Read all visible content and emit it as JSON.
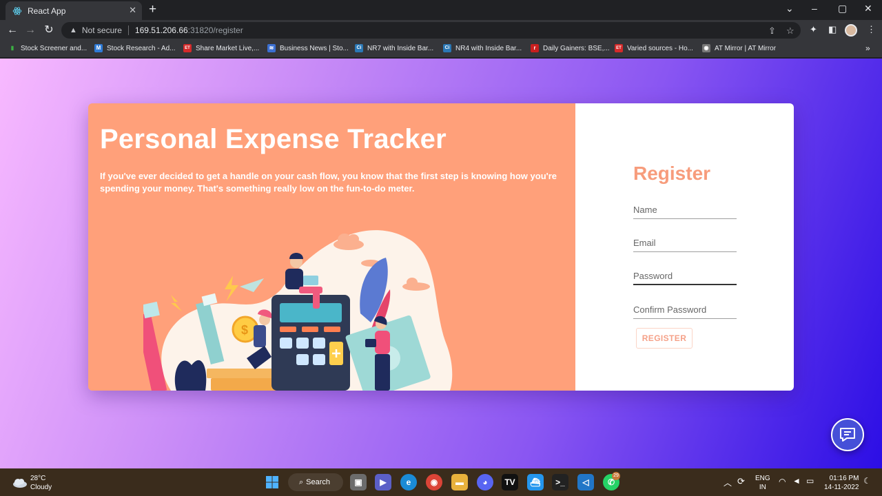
{
  "browser": {
    "tab_title": "React App",
    "url_warning": "Not secure",
    "url_host": "169.51.206.66",
    "url_path": ":31820/register",
    "bookmarks": [
      {
        "label": "Stock Screener and...",
        "color": "#2e8b2e",
        "icon": "chart-bars-icon"
      },
      {
        "label": "Stock Research - Ad...",
        "color": "#2f7bd6",
        "icon": "M"
      },
      {
        "label": "Share Market Live,...",
        "color": "#d42a2a",
        "icon": "ET"
      },
      {
        "label": "Business News | Sto...",
        "color": "#3b6fd1",
        "icon": "news-icon"
      },
      {
        "label": "NR7 with Inside Bar...",
        "color": "#2b78b5",
        "icon": "Ci"
      },
      {
        "label": "NR4 with Inside Bar...",
        "color": "#2b78b5",
        "icon": "Ci"
      },
      {
        "label": "Daily Gainers: BSE,...",
        "color": "#c81f1f",
        "icon": "r"
      },
      {
        "label": "Varied sources - Ho...",
        "color": "#d42a2a",
        "icon": "ET"
      },
      {
        "label": "AT Mirror | AT Mirror",
        "color": "#777777",
        "icon": "mirror-icon"
      }
    ]
  },
  "hero": {
    "title": "Personal Expense Tracker",
    "subtitle": "If you've ever decided to get a handle on your cash flow, you know that the first step is knowing how you're spending your money. That's something really low on the fun-to-do meter."
  },
  "register": {
    "title": "Register",
    "name_placeholder": "Name",
    "email_placeholder": "Email",
    "password_placeholder": "Password",
    "confirm_placeholder": "Confirm Password",
    "button_label": "REGISTER"
  },
  "taskbar": {
    "temperature": "28°C",
    "weather": "Cloudy",
    "search_label": "Search",
    "lang_top": "ENG",
    "lang_bottom": "IN",
    "time": "01:16 PM",
    "date": "14-11-2022",
    "whatsapp_badge": "29"
  },
  "colors": {
    "left_panel": "#ffa07a",
    "accent": "#f79c7c",
    "fab": "#4650d8"
  }
}
